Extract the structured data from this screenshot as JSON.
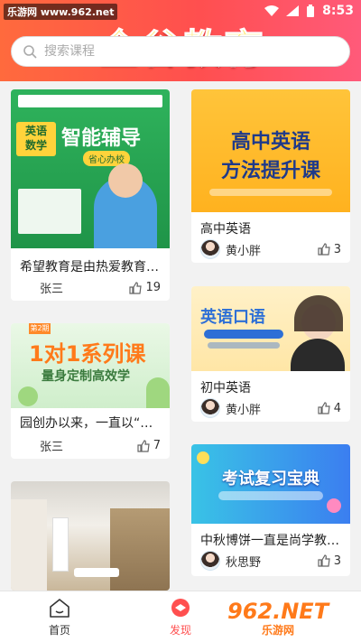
{
  "status_bar": {
    "watermark": "乐游网 www.962.net",
    "time": "8:53"
  },
  "header": {
    "brand": "金谷教育"
  },
  "search": {
    "placeholder": "搜索课程"
  },
  "cards": [
    {
      "title": "希望教育是由热爱教育…",
      "author": "张三",
      "likes": "19",
      "thumb": {
        "headline": "智能辅导",
        "tag": "英语\n数学",
        "sub": "省心办校"
      }
    },
    {
      "title": "园创办以来，一直以“健…",
      "author": "张三",
      "likes": "7",
      "thumb": {
        "badge": "第2期",
        "headline": "1对1系列课",
        "sub": "量身定制高效学"
      }
    },
    {
      "title": "",
      "author": "",
      "likes": ""
    },
    {
      "title": "高中英语",
      "author": "黄小胖",
      "likes": "3",
      "thumb": {
        "headline1": "高中英语",
        "headline2": "方法提升课"
      }
    },
    {
      "title": "初中英语",
      "author": "黄小胖",
      "likes": "4",
      "thumb": {
        "headline": "英语口语"
      }
    },
    {
      "title": "中秋博饼一直是尚学教…",
      "author": "秋思野",
      "likes": "3",
      "thumb": {
        "headline": "考试复习宝典"
      }
    }
  ],
  "tabbar": {
    "home": "首页",
    "discover": "发现"
  },
  "watermark_bottom": {
    "big": "962.NET",
    "small": "乐游网"
  },
  "colors": {
    "accent": "#ff4f4f",
    "brand_text": "#ffe86a"
  }
}
